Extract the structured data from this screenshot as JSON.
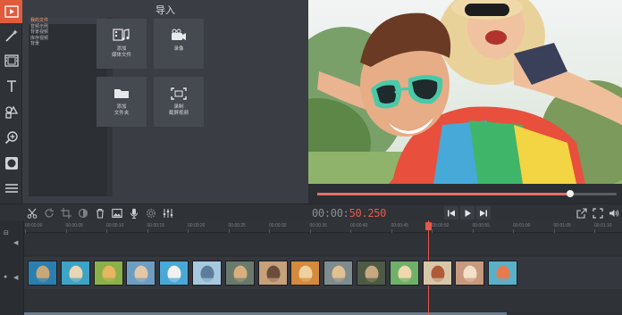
{
  "sidebar": {
    "items": [
      {
        "icon": "video-import-icon",
        "active": true
      },
      {
        "icon": "magic-wand-icon"
      },
      {
        "icon": "film-strip-icon"
      },
      {
        "icon": "text-icon"
      },
      {
        "icon": "shapes-icon"
      },
      {
        "icon": "zoom-icon"
      },
      {
        "icon": "record-icon"
      },
      {
        "icon": "menu-icon"
      }
    ]
  },
  "import_panel": {
    "title": "导入",
    "categories": [
      "我的文件",
      "音频示例",
      "背景视频",
      "库存视频",
      "背景"
    ],
    "selected_category": 0,
    "tiles": [
      {
        "label": "添加\n媒体文件",
        "icon": "add-media-icon"
      },
      {
        "label": "录像",
        "icon": "camera-icon"
      },
      {
        "label": "添加\n文件夹",
        "icon": "folder-icon"
      },
      {
        "label": "录制\n截屏视频",
        "icon": "screen-capture-icon"
      }
    ]
  },
  "player": {
    "progress": 0.845
  },
  "toolbar": {
    "timecode_dim": "00:00:",
    "timecode_active": "50.250",
    "left_tools": [
      "cut-icon",
      "rotate-icon",
      "crop-icon",
      "color-adjust-icon",
      "delete-icon",
      "image-icon",
      "microphone-icon",
      "settings-icon",
      "equalizer-icon"
    ],
    "playback": [
      "skip-back-icon",
      "play-icon",
      "skip-forward-icon"
    ],
    "right_tools": [
      "export-icon",
      "fullscreen-icon",
      "volume-icon"
    ]
  },
  "timeline": {
    "ticks": [
      "00:00:00",
      "00:00:05",
      "00:00:10",
      "00:00:15",
      "00:00:20",
      "00:00:25",
      "00:00:30",
      "00:00:35",
      "00:00:40",
      "00:00:45",
      "00:00:50",
      "00:00:55",
      "00:01:00",
      "00:01:05",
      "00:01:10"
    ],
    "clips": [
      {
        "color": "#2a7fb0",
        "accent": "#c9a878"
      },
      {
        "color": "#3da4c8",
        "accent": "#e8d6b4"
      },
      {
        "color": "#8bb04a",
        "accent": "#e8b560"
      },
      {
        "color": "#6d9ec2",
        "accent": "#e2c7a8"
      },
      {
        "color": "#4aa8d8",
        "accent": "#f1f1f1"
      },
      {
        "color": "#a6c9df",
        "accent": "#5c7d9a"
      },
      {
        "color": "#6a7b6d",
        "accent": "#d8b080"
      },
      {
        "color": "#c7a07c",
        "accent": "#6b4c3a"
      },
      {
        "color": "#d48a3c",
        "accent": "#f0d0a0"
      },
      {
        "color": "#7f8c8f",
        "accent": "#e0c090"
      },
      {
        "color": "#4d5a45",
        "accent": "#c8a880"
      },
      {
        "color": "#6fb06a",
        "accent": "#efd8b0"
      },
      {
        "color": "#d8c6a8",
        "accent": "#b05a3a"
      },
      {
        "color": "#c79a80",
        "accent": "#f2e0c8"
      },
      {
        "color": "#5ab0c9",
        "accent": "#e87a50"
      }
    ]
  }
}
